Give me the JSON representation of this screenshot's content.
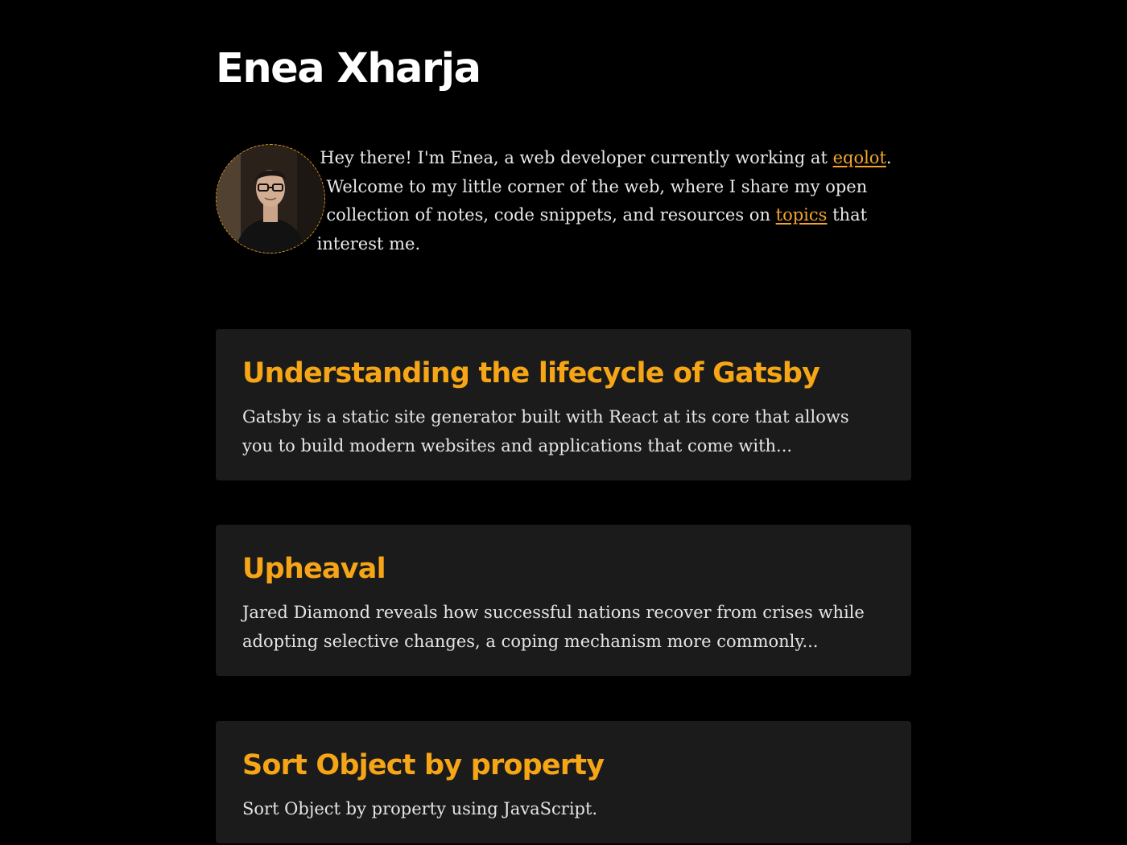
{
  "site": {
    "title": "Enea Xharja"
  },
  "bio": {
    "text_1": "Hey there! I'm Enea, a web developer currently working at ",
    "link_1": "eqolot",
    "text_2": ". Welcome to my little corner of the web, where I share my open collection of notes, code snippets, and resources on ",
    "link_2": "topics",
    "text_3": " that interest me."
  },
  "posts": [
    {
      "title": "Understanding the lifecycle of Gatsby",
      "excerpt": "Gatsby is a static site generator built with React at its core that allows you to build modern websites and applications that come with..."
    },
    {
      "title": "Upheaval",
      "excerpt": "Jared Diamond reveals how successful nations recover from crises while adopting selective changes, a coping mechanism more commonly..."
    },
    {
      "title": "Sort Object by property",
      "excerpt": "Sort Object by property using JavaScript."
    }
  ],
  "colors": {
    "background": "#000000",
    "accent": "#f5a516",
    "card": "#1b1b1b"
  }
}
